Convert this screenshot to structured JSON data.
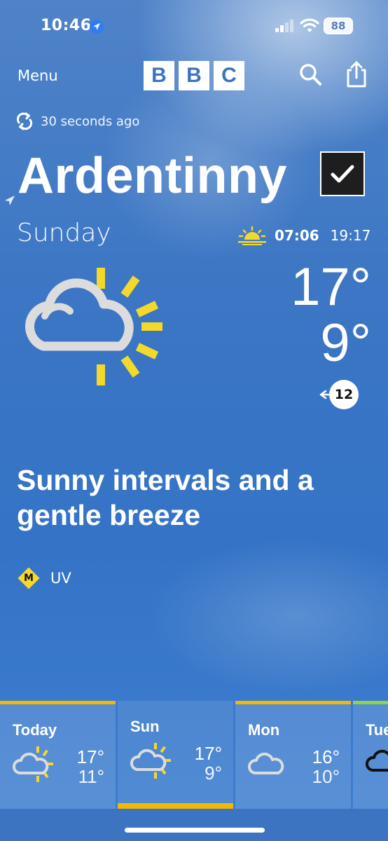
{
  "status_bar": {
    "time": "10:46",
    "battery": "88",
    "icons": [
      "location-arrow-icon",
      "signal-icon",
      "wifi-icon",
      "battery-icon"
    ]
  },
  "header": {
    "menu_label": "Menu",
    "logo_letters": [
      "B",
      "B",
      "C"
    ],
    "icons": [
      "search-icon",
      "share-icon"
    ]
  },
  "updated": {
    "text": "30 seconds ago",
    "icon": "refresh-icon"
  },
  "location": {
    "name": "Ardentinny",
    "saved_icon": "checkmark-icon"
  },
  "today": {
    "day": "Sunday",
    "sunrise": "07:06",
    "sunset": "19:17",
    "icon": "sunny-intervals-icon",
    "high": "17°",
    "low": "9°",
    "wind_speed": "12",
    "summary": "Sunny intervals and a gentle breeze",
    "uv_level": "M",
    "uv_label": "UV"
  },
  "colors": {
    "sun_yellow": "#f4d92b",
    "cloud_grey": "#d8d8d8",
    "strip_accent": "#f3b900",
    "tuesday_accent": "#8fd14f"
  },
  "forecast": [
    {
      "day": "Today",
      "high": "17°",
      "low": "11°",
      "icon": "sunny-intervals-icon"
    },
    {
      "day": "Sun",
      "high": "17°",
      "low": "9°",
      "icon": "sunny-intervals-icon"
    },
    {
      "day": "Mon",
      "high": "16°",
      "low": "10°",
      "icon": "cloud-icon"
    },
    {
      "day": "Tue",
      "high": "",
      "low": "",
      "icon": "rain-cloud-icon"
    }
  ]
}
